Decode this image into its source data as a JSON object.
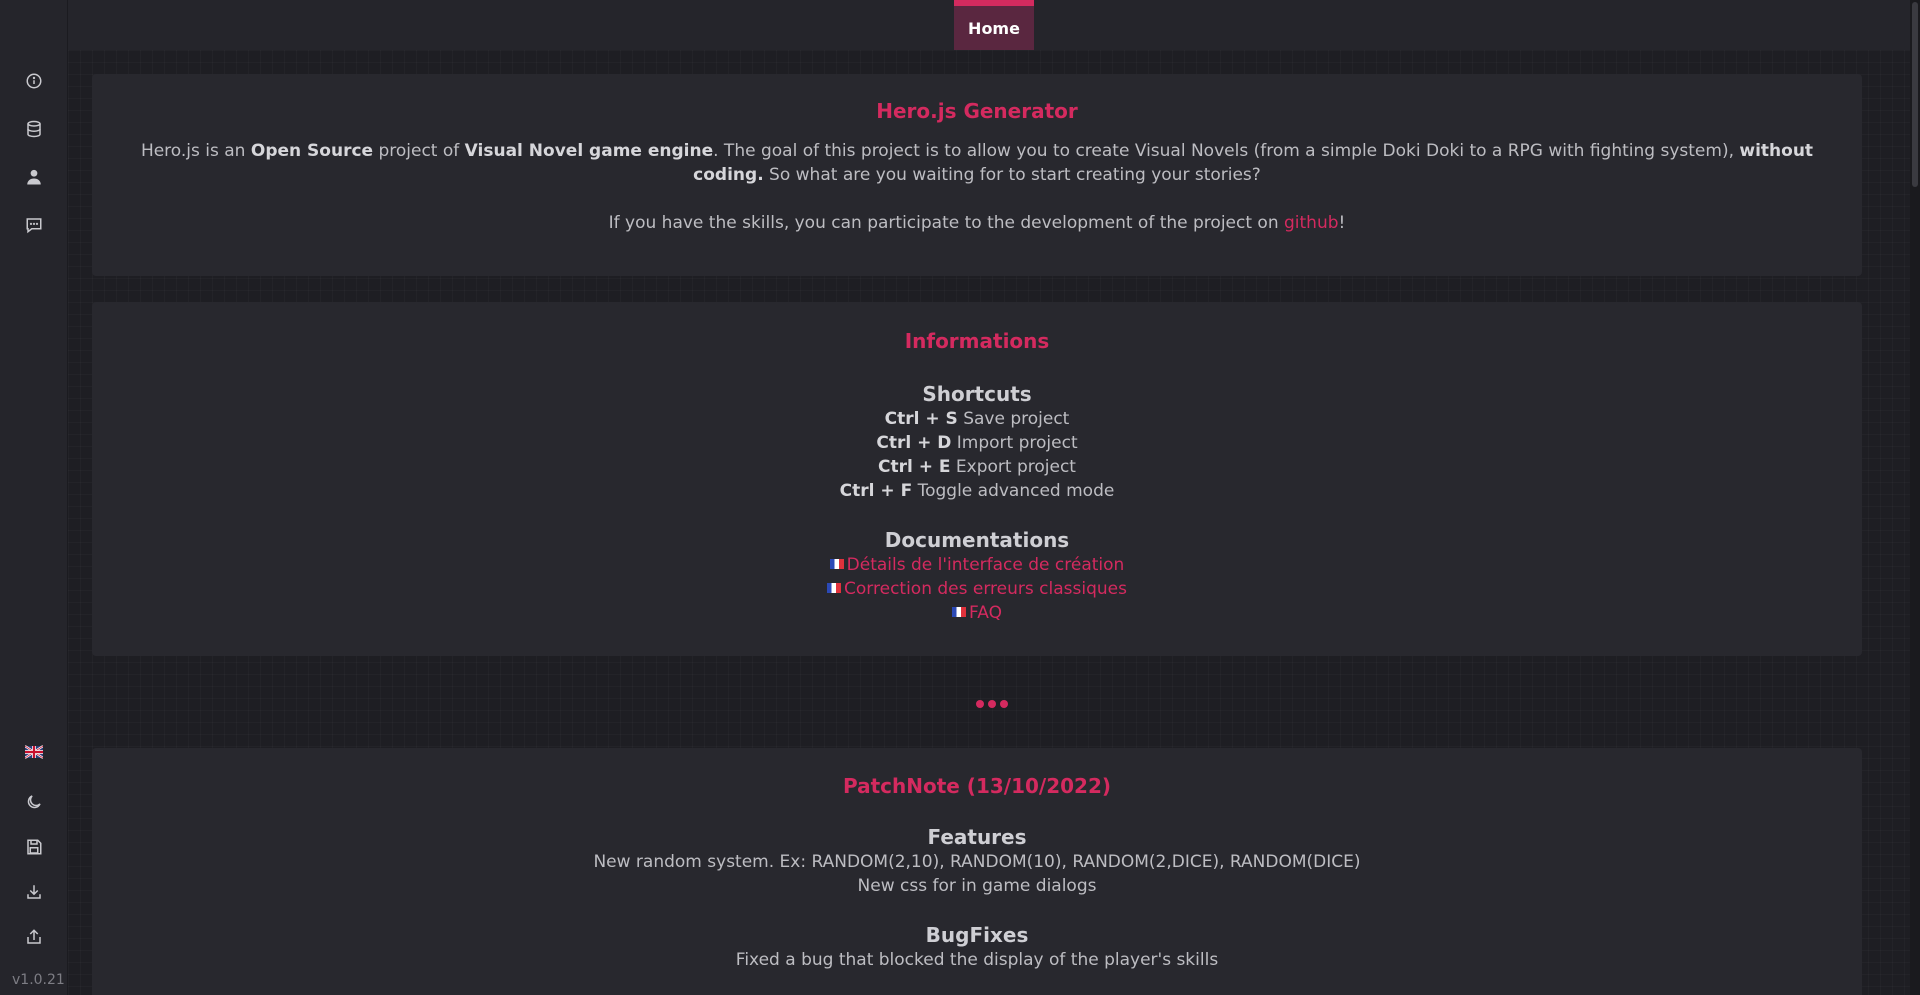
{
  "sidebar": {
    "top_icons": [
      "info-icon",
      "database-icon",
      "user-icon",
      "chat-icon"
    ],
    "bottom_icons": [
      "uk-flag-icon",
      "moon-icon",
      "save-icon",
      "download-icon",
      "upload-icon"
    ],
    "version": "v1.0.21"
  },
  "topbar": {
    "home_tab": "Home"
  },
  "intro": {
    "title": "Hero.js Generator",
    "p1_a": "Hero.js is an ",
    "p1_b": "Open Source",
    "p1_c": " project of ",
    "p1_d": "Visual Novel game engine",
    "p1_e": ". The goal of this project is to allow you to create Visual Novels (from a simple Doki Doki to a RPG with fighting system), ",
    "p1_f": "without coding.",
    "p1_g": " So what are you waiting for to start creating your stories?",
    "p2_a": "If you have the skills, you can participate to the development of the project on ",
    "p2_link": "github",
    "p2_b": "!"
  },
  "info": {
    "title": "Informations",
    "shortcuts_head": "Shortcuts",
    "shortcuts": [
      {
        "keys": "Ctrl + S",
        "label": " Save project"
      },
      {
        "keys": "Ctrl + D",
        "label": " Import project"
      },
      {
        "keys": "Ctrl + E",
        "label": " Export project"
      },
      {
        "keys": "Ctrl + F",
        "label": " Toggle advanced mode"
      }
    ],
    "docs_head": "Documentations",
    "docs": [
      "Détails de l'interface de création",
      "Correction des erreurs classiques",
      "FAQ"
    ]
  },
  "patch": {
    "title": "PatchNote (13/10/2022)",
    "features_head": "Features",
    "features": [
      "New random system. Ex: RANDOM(2,10), RANDOM(10), RANDOM(2,DICE), RANDOM(DICE)",
      "New css for in game dialogs"
    ],
    "bugfix_head": "BugFixes",
    "bugfixes": [
      "Fixed a bug that blocked the display of the player's skills"
    ]
  },
  "colors": {
    "accent": "#d42a5f",
    "bg": "#1e1e23",
    "card": "#28282e"
  }
}
